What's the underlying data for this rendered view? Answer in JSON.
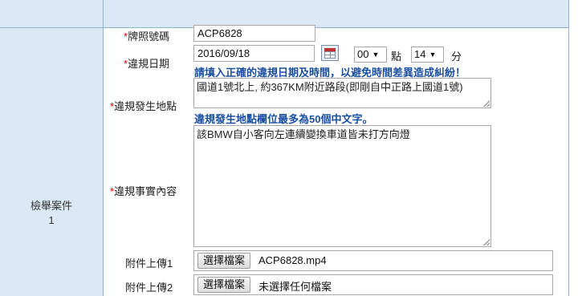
{
  "form": {
    "case": {
      "title": "檢舉案件",
      "number": "1"
    },
    "plate": {
      "required_mark": "*",
      "label": "牌照號碼",
      "value": "ACP6828"
    },
    "date": {
      "required_mark": "*",
      "label": "違規日期",
      "value": "2016/09/18",
      "hour": "00",
      "hour_unit": "點",
      "minute": "14",
      "minute_unit": "分",
      "notice": "請填入正確的違規日期及時間，以避免時間差異造成糾紛！"
    },
    "location": {
      "required_mark": "*",
      "label": "違規發生地點",
      "value": "國道1號北上, 約367KM附近路段(即剛自中正路上國道1號)",
      "notice": "違規發生地點欄位最多為50個中文字。"
    },
    "content": {
      "required_mark": "*",
      "label": "違規事實內容",
      "value": "該BMW自小客向左連續變換車道皆未打方向燈"
    },
    "attachments": [
      {
        "label": "附件上傳1",
        "button": "選擇檔案",
        "file": "ACP6828.mp4"
      },
      {
        "label": "附件上傳2",
        "button": "選擇檔案",
        "file": "未選擇任何檔案"
      }
    ]
  },
  "icons": {
    "calendar": "calendar-icon",
    "dropdown": "chevron-down-icon"
  },
  "colors": {
    "panel": "#dbe9f6",
    "border": "#8fb0cf",
    "required": "#d40000",
    "notice": "#1a4fa0"
  }
}
